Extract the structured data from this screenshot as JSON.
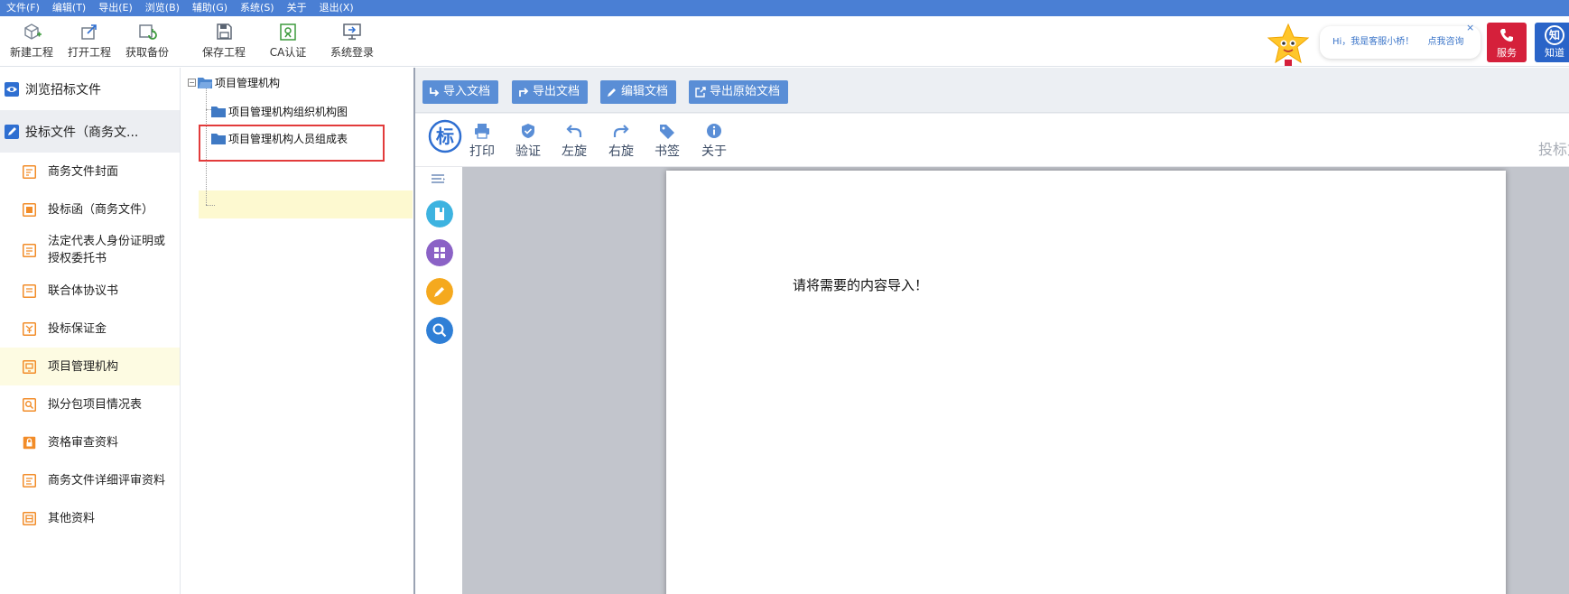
{
  "menubar": {
    "items": [
      "文件(F)",
      "编辑(T)",
      "导出(E)",
      "浏览(B)",
      "辅助(G)",
      "系统(S)",
      "关于",
      "退出(X)"
    ]
  },
  "toolbar": {
    "new_project": "新建工程",
    "open_project": "打开工程",
    "get_backup": "获取备份",
    "save_project": "保存工程",
    "ca_auth": "CA认证",
    "system_login": "系统登录"
  },
  "support": {
    "greeting": "Hi，我是客服小桥！",
    "consult": "点我咨询",
    "close": "×",
    "service_label": "服务",
    "zhi_glyph": "知",
    "zhi_label": "知道"
  },
  "leftnav": {
    "browse": "浏览招标文件",
    "bid_docs": "投标文件（商务文...",
    "items": [
      "商务文件封面",
      "投标函（商务文件）",
      "法定代表人身份证明或授权委托书",
      "联合体协议书",
      "投标保证金",
      "项目管理机构",
      "拟分包项目情况表",
      "资格审查资料",
      "商务文件详细评审资料",
      "其他资料"
    ]
  },
  "tree": {
    "root": "项目管理机构",
    "children": [
      "项目管理机构组织机构图",
      "项目管理机构人员组成表"
    ],
    "expander": "−"
  },
  "doc_toolbar": {
    "import": "导入文档",
    "export": "导出文档",
    "edit": "编辑文档",
    "export_original": "导出原始文档"
  },
  "viewer": {
    "logo_glyph": "标",
    "print": "打印",
    "verify": "验证",
    "rotate_left": "左旋",
    "rotate_right": "右旋",
    "bookmark": "书签",
    "about": "关于",
    "cut_label": "投标文"
  },
  "page": {
    "message": "请将需要的内容导入！"
  },
  "colors": {
    "menubar": "#4a7fd4",
    "doc_button": "#5a8ed6",
    "service_red": "#d5203b",
    "zhi_blue": "#2a64c8",
    "nav_icon_orange": "#f28c28",
    "selection_border": "#e23b3b"
  }
}
